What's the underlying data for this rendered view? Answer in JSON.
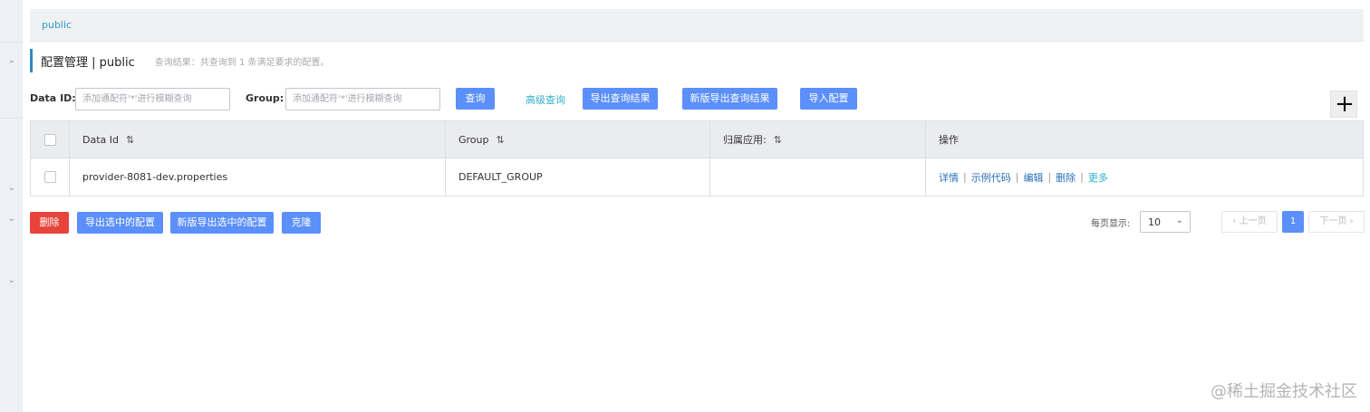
{
  "namespace": {
    "label": "public"
  },
  "header": {
    "title": "配置管理 | public",
    "result": "查询结果：共查询到 1 条满足要求的配置。"
  },
  "search": {
    "data_id_label": "Data ID:",
    "data_id_placeholder": "添加通配符'*'进行模糊查询",
    "group_label": "Group:",
    "group_placeholder": "添加通配符'*'进行模糊查询",
    "query_label": "查询",
    "advanced_label": "高级查询",
    "export_label": "导出查询结果",
    "export_new_label": "新版导出查询结果",
    "import_label": "导入配置"
  },
  "icons": {
    "add": "plus-icon",
    "sort": "sort-icon",
    "collapse": "chevron-up-icon",
    "expand": "chevron-down-icon"
  },
  "table": {
    "columns": [
      "Data Id",
      "Group",
      "归属应用:",
      "操作"
    ],
    "rows": [
      {
        "data_id": "provider-8081-dev.properties",
        "group": "DEFAULT_GROUP",
        "app": "",
        "actions": [
          "详情",
          "示例代码",
          "编辑",
          "删除",
          "更多"
        ]
      }
    ]
  },
  "bulk": {
    "delete_label": "删除",
    "export_selected_label": "导出选中的配置",
    "export_selected_new_label": "新版导出选中的配置",
    "clone_label": "克隆"
  },
  "pagination": {
    "page_size_label": "每页显示:",
    "page_size": "10",
    "prev_label": "上一页",
    "current": "1",
    "next_label": "下一页"
  },
  "colors": {
    "primary": "#5b8ff9",
    "danger": "#e8443a",
    "link": "#2eb2c9",
    "accent": "#2e8bc0"
  },
  "watermark": "@稀土掘金技术社区"
}
